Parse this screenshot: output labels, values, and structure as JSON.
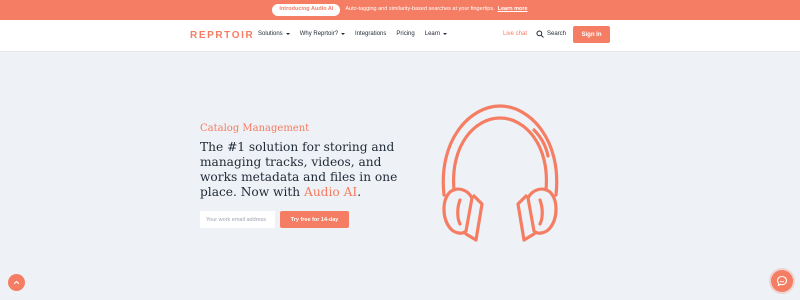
{
  "banner": {
    "pill": "Introducing Audio AI",
    "text": "Auto-tagging and similarity-based searches at your fingertips.",
    "link": "Learn more"
  },
  "nav": {
    "logo": "REPRTOIR",
    "items": [
      {
        "label": "Solutions",
        "dropdown": true
      },
      {
        "label": "Why Reprtoir?",
        "dropdown": true
      },
      {
        "label": "Integrations",
        "dropdown": false
      },
      {
        "label": "Pricing",
        "dropdown": false
      },
      {
        "label": "Learn",
        "dropdown": true
      }
    ],
    "live_chat": "Live chat",
    "search": "Search",
    "signin": "Sign In"
  },
  "hero": {
    "eyebrow": "Catalog Management",
    "headline": "The #1 solution for storing and managing tracks, videos, and works metadata and files in one place. Now with",
    "headline_accent": "Audio AI",
    "headline_end": ".",
    "email_placeholder": "Your work email address",
    "cta": "Try free for 14-day"
  },
  "icons": {
    "search": "search-icon",
    "headphones": "headphones-illustration",
    "scroll_top": "chevron-up-icon",
    "chat": "chat-icon"
  },
  "colors": {
    "accent": "#f47d63",
    "background": "#eef1f5",
    "text": "#1f2937"
  }
}
